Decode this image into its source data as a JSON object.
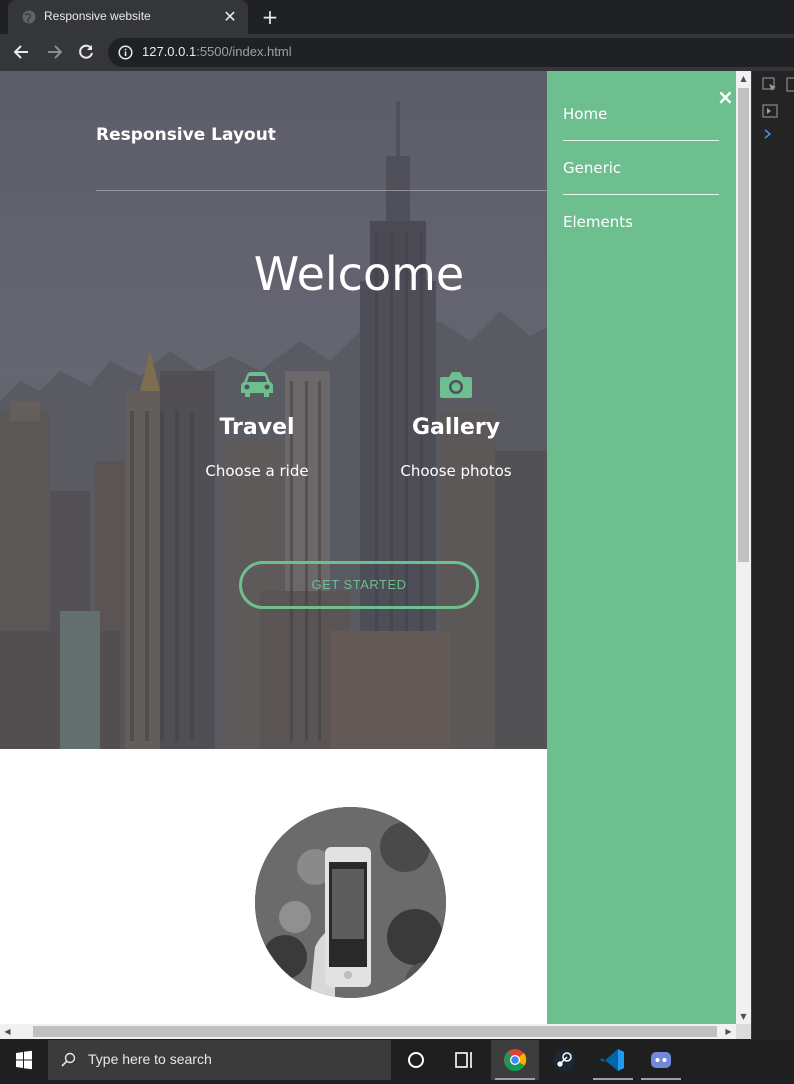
{
  "browser": {
    "tab_title": "Responsive website",
    "url_host": "127.0.0.1",
    "url_path": ":5500/index.html"
  },
  "page": {
    "site_title": "Responsive Layout",
    "welcome": "Welcome",
    "features": [
      {
        "title": "Travel",
        "text": "Choose a ride",
        "icon": "car-icon"
      },
      {
        "title": "Gallery",
        "text": "Choose photos",
        "icon": "camera-icon"
      }
    ],
    "cta_label": "GET STARTED"
  },
  "side_menu": {
    "close_glyph": "×",
    "items": [
      {
        "label": "Home"
      },
      {
        "label": "Generic"
      },
      {
        "label": "Elements"
      }
    ]
  },
  "taskbar": {
    "search_placeholder": "Type here to search",
    "pinned": [
      "cortana-icon",
      "task-view-icon",
      "chrome-icon",
      "steam-icon",
      "vscode-icon",
      "discord-icon"
    ]
  },
  "colors": {
    "accent": "#6dbf8f",
    "chrome_dark": "#202124",
    "chrome_toolbar": "#35363a"
  }
}
